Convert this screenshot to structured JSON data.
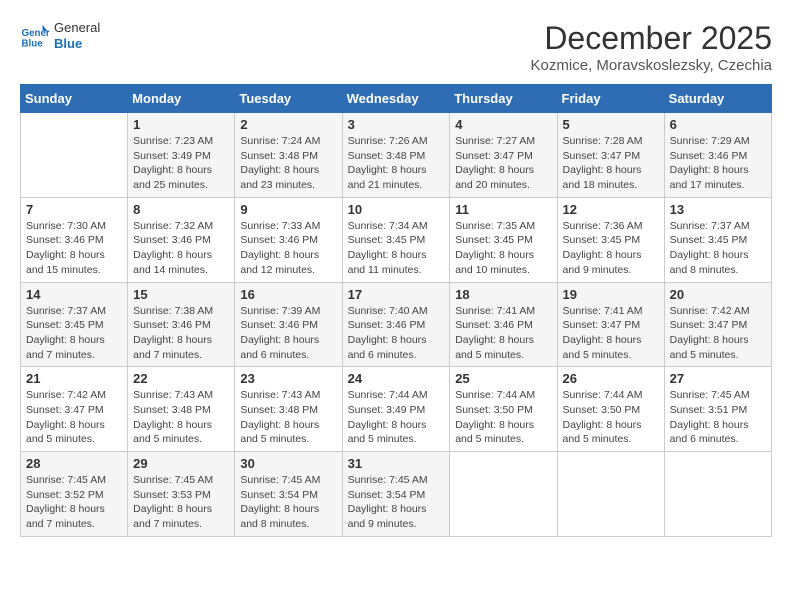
{
  "logo": {
    "text_general": "General",
    "text_blue": "Blue"
  },
  "title": "December 2025",
  "location": "Kozmice, Moravskoslezsky, Czechia",
  "weekdays": [
    "Sunday",
    "Monday",
    "Tuesday",
    "Wednesday",
    "Thursday",
    "Friday",
    "Saturday"
  ],
  "weeks": [
    [
      {
        "day": "",
        "info": ""
      },
      {
        "day": "1",
        "info": "Sunrise: 7:23 AM\nSunset: 3:49 PM\nDaylight: 8 hours\nand 25 minutes."
      },
      {
        "day": "2",
        "info": "Sunrise: 7:24 AM\nSunset: 3:48 PM\nDaylight: 8 hours\nand 23 minutes."
      },
      {
        "day": "3",
        "info": "Sunrise: 7:26 AM\nSunset: 3:48 PM\nDaylight: 8 hours\nand 21 minutes."
      },
      {
        "day": "4",
        "info": "Sunrise: 7:27 AM\nSunset: 3:47 PM\nDaylight: 8 hours\nand 20 minutes."
      },
      {
        "day": "5",
        "info": "Sunrise: 7:28 AM\nSunset: 3:47 PM\nDaylight: 8 hours\nand 18 minutes."
      },
      {
        "day": "6",
        "info": "Sunrise: 7:29 AM\nSunset: 3:46 PM\nDaylight: 8 hours\nand 17 minutes."
      }
    ],
    [
      {
        "day": "7",
        "info": "Sunrise: 7:30 AM\nSunset: 3:46 PM\nDaylight: 8 hours\nand 15 minutes."
      },
      {
        "day": "8",
        "info": "Sunrise: 7:32 AM\nSunset: 3:46 PM\nDaylight: 8 hours\nand 14 minutes."
      },
      {
        "day": "9",
        "info": "Sunrise: 7:33 AM\nSunset: 3:46 PM\nDaylight: 8 hours\nand 12 minutes."
      },
      {
        "day": "10",
        "info": "Sunrise: 7:34 AM\nSunset: 3:45 PM\nDaylight: 8 hours\nand 11 minutes."
      },
      {
        "day": "11",
        "info": "Sunrise: 7:35 AM\nSunset: 3:45 PM\nDaylight: 8 hours\nand 10 minutes."
      },
      {
        "day": "12",
        "info": "Sunrise: 7:36 AM\nSunset: 3:45 PM\nDaylight: 8 hours\nand 9 minutes."
      },
      {
        "day": "13",
        "info": "Sunrise: 7:37 AM\nSunset: 3:45 PM\nDaylight: 8 hours\nand 8 minutes."
      }
    ],
    [
      {
        "day": "14",
        "info": "Sunrise: 7:37 AM\nSunset: 3:45 PM\nDaylight: 8 hours\nand 7 minutes."
      },
      {
        "day": "15",
        "info": "Sunrise: 7:38 AM\nSunset: 3:46 PM\nDaylight: 8 hours\nand 7 minutes."
      },
      {
        "day": "16",
        "info": "Sunrise: 7:39 AM\nSunset: 3:46 PM\nDaylight: 8 hours\nand 6 minutes."
      },
      {
        "day": "17",
        "info": "Sunrise: 7:40 AM\nSunset: 3:46 PM\nDaylight: 8 hours\nand 6 minutes."
      },
      {
        "day": "18",
        "info": "Sunrise: 7:41 AM\nSunset: 3:46 PM\nDaylight: 8 hours\nand 5 minutes."
      },
      {
        "day": "19",
        "info": "Sunrise: 7:41 AM\nSunset: 3:47 PM\nDaylight: 8 hours\nand 5 minutes."
      },
      {
        "day": "20",
        "info": "Sunrise: 7:42 AM\nSunset: 3:47 PM\nDaylight: 8 hours\nand 5 minutes."
      }
    ],
    [
      {
        "day": "21",
        "info": "Sunrise: 7:42 AM\nSunset: 3:47 PM\nDaylight: 8 hours\nand 5 minutes."
      },
      {
        "day": "22",
        "info": "Sunrise: 7:43 AM\nSunset: 3:48 PM\nDaylight: 8 hours\nand 5 minutes."
      },
      {
        "day": "23",
        "info": "Sunrise: 7:43 AM\nSunset: 3:48 PM\nDaylight: 8 hours\nand 5 minutes."
      },
      {
        "day": "24",
        "info": "Sunrise: 7:44 AM\nSunset: 3:49 PM\nDaylight: 8 hours\nand 5 minutes."
      },
      {
        "day": "25",
        "info": "Sunrise: 7:44 AM\nSunset: 3:50 PM\nDaylight: 8 hours\nand 5 minutes."
      },
      {
        "day": "26",
        "info": "Sunrise: 7:44 AM\nSunset: 3:50 PM\nDaylight: 8 hours\nand 5 minutes."
      },
      {
        "day": "27",
        "info": "Sunrise: 7:45 AM\nSunset: 3:51 PM\nDaylight: 8 hours\nand 6 minutes."
      }
    ],
    [
      {
        "day": "28",
        "info": "Sunrise: 7:45 AM\nSunset: 3:52 PM\nDaylight: 8 hours\nand 7 minutes."
      },
      {
        "day": "29",
        "info": "Sunrise: 7:45 AM\nSunset: 3:53 PM\nDaylight: 8 hours\nand 7 minutes."
      },
      {
        "day": "30",
        "info": "Sunrise: 7:45 AM\nSunset: 3:54 PM\nDaylight: 8 hours\nand 8 minutes."
      },
      {
        "day": "31",
        "info": "Sunrise: 7:45 AM\nSunset: 3:54 PM\nDaylight: 8 hours\nand 9 minutes."
      },
      {
        "day": "",
        "info": ""
      },
      {
        "day": "",
        "info": ""
      },
      {
        "day": "",
        "info": ""
      }
    ]
  ]
}
